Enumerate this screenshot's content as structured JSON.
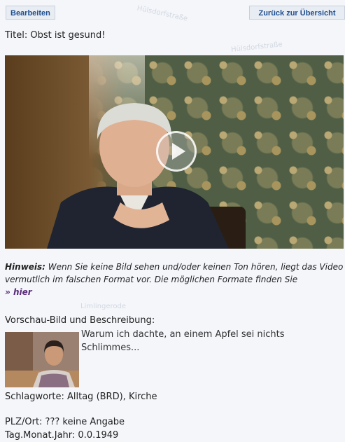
{
  "toolbar": {
    "edit_label": "Bearbeiten",
    "back_label": "Zurück zur Übersicht"
  },
  "title_line": "Titel: Obst ist gesund!",
  "video": {
    "play_icon": "play-icon"
  },
  "hint": {
    "label": "Hinweis:",
    "text": " Wenn Sie keine Bild sehen und/oder keinen Ton hören, liegt das Video vermutlich im falschen Format vor. Die möglichen Formate finden Sie",
    "link_label": "» hier"
  },
  "preview": {
    "label": "Vorschau-Bild und Beschreibung:",
    "description": "Warum ich dachte, an einem Apfel sei nichts Schlimmes..."
  },
  "keywords": "Schlagworte: Alltag (BRD), Kirche",
  "place": "PLZ/Ort: ??? keine Angabe",
  "date": "Tag.Monat.Jahr: 0.0.1949",
  "map_labels": [
    "Hülsdorfstraße",
    "Hülsdorfstraße",
    "Limlingerode"
  ],
  "colors": {
    "background": "#f4f6fa",
    "button_text": "#1f4f8f",
    "link": "#5a2c7a"
  }
}
